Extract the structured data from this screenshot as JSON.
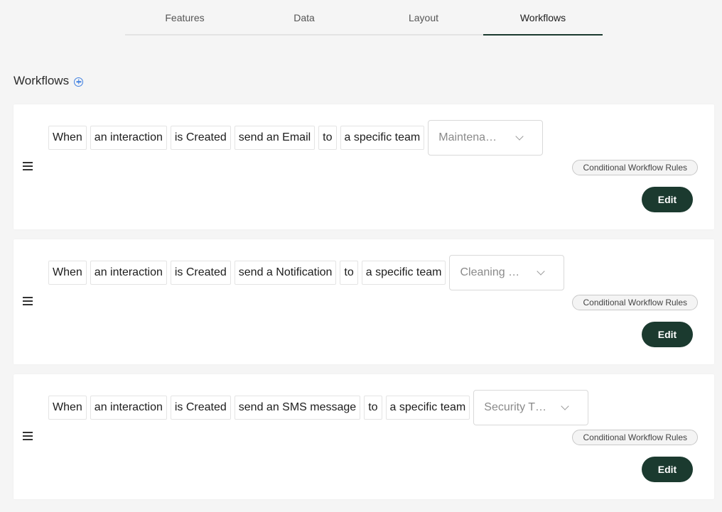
{
  "tabs": [
    {
      "label": "Features"
    },
    {
      "label": "Data"
    },
    {
      "label": "Layout"
    },
    {
      "label": "Workflows",
      "active": true
    }
  ],
  "section": {
    "title": "Workflows",
    "add_icon": "add-circle-icon"
  },
  "workflows": [
    {
      "when": "When",
      "subject": "an interaction",
      "event": "is Created",
      "action": "send an Email",
      "to": "to",
      "target": "a specific team",
      "team": "Maintena…",
      "badge": "Conditional Workflow Rules",
      "edit": "Edit"
    },
    {
      "when": "When",
      "subject": "an interaction",
      "event": "is Created",
      "action": "send a Notification",
      "to": "to",
      "target": "a specific team",
      "team": "Cleaning …",
      "badge": "Conditional Workflow Rules",
      "edit": "Edit"
    },
    {
      "when": "When",
      "subject": "an interaction",
      "event": "is Created",
      "action": "send an SMS message",
      "to": "to",
      "target": "a specific team",
      "team": "Security T…",
      "badge": "Conditional Workflow Rules",
      "edit": "Edit"
    }
  ],
  "colors": {
    "accent": "#1b3a2f",
    "add_icon": "#3f7fe0",
    "background": "#f5f5f5"
  }
}
